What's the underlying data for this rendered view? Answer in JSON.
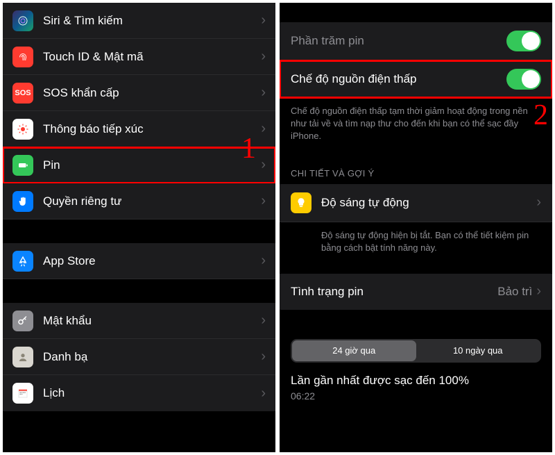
{
  "left": {
    "marker": "1",
    "items": [
      {
        "label": "Siri & Tìm kiếm",
        "icon": "siri",
        "bg": "linear-gradient(135deg,#2e2e58,#0d4a6f,#1a8f6a)"
      },
      {
        "label": "Touch ID & Mật mã",
        "icon": "fingerprint",
        "bg": "#ff3b30"
      },
      {
        "label": "SOS khẩn cấp",
        "icon": "sos",
        "bg": "#ff3b30"
      },
      {
        "label": "Thông báo tiếp xúc",
        "icon": "exposure",
        "bg": "#fff"
      },
      {
        "label": "Pin",
        "icon": "battery",
        "bg": "#34c759"
      },
      {
        "label": "Quyền riêng tư",
        "icon": "hand",
        "bg": "#007aff"
      }
    ],
    "items2": [
      {
        "label": "App Store",
        "icon": "appstore",
        "bg": "#0a84ff"
      }
    ],
    "items3": [
      {
        "label": "Mật khẩu",
        "icon": "key",
        "bg": "#8e8e93"
      },
      {
        "label": "Danh bạ",
        "icon": "contacts",
        "bg": "#d9d6cf"
      },
      {
        "label": "Lịch",
        "icon": "calendar",
        "bg": "#fff"
      }
    ]
  },
  "right": {
    "marker": "2",
    "battery_percent_label": "Phần trăm pin",
    "low_power_label": "Chế độ nguồn điện thấp",
    "low_power_desc": "Chế độ nguồn điện thấp tạm thời giảm hoạt động trong nền như tải về và tìm nạp thư cho đến khi bạn có thể sạc đầy iPhone.",
    "detail_header": "CHI TIẾT VÀ GỢI Ý",
    "auto_brightness_label": "Độ sáng tự động",
    "auto_brightness_desc": "Độ sáng tự động hiện bị tắt. Bạn có thể tiết kiệm pin bằng cách bật tính năng này.",
    "health_label": "Tình trạng pin",
    "health_value": "Bảo trì",
    "seg_24h": "24 giờ qua",
    "seg_10d": "10 ngày qua",
    "last_charge": "Lần gần nhất được sạc đến 100%",
    "last_charge_time": "06:22"
  }
}
